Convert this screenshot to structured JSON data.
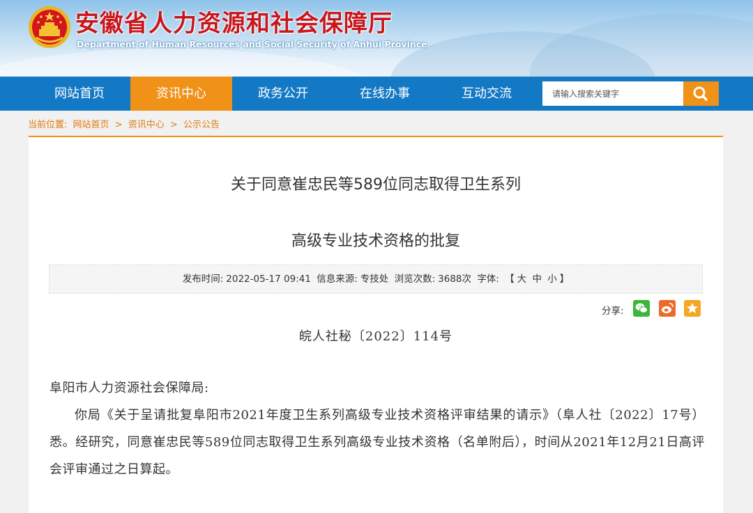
{
  "header": {
    "title": "安徽省人力资源和社会保障厅",
    "subtitle": "Department of Human Resources and Social Security of Anhui Province",
    "emblem_icon": "national-emblem",
    "title_color": "#c8161d"
  },
  "nav": {
    "items": [
      {
        "label": "网站首页"
      },
      {
        "label": "资讯中心"
      },
      {
        "label": "政务公开"
      },
      {
        "label": "在线办事"
      },
      {
        "label": "互动交流"
      }
    ],
    "active_index": 1,
    "bg_color": "#1479c5",
    "active_color": "#f09118",
    "search": {
      "placeholder": "请输入搜索关键字",
      "value": "",
      "button_icon": "search-icon"
    }
  },
  "breadcrumb": {
    "prefix": "当前位置:",
    "items": [
      "网站首页",
      "资讯中心",
      "公示公告"
    ],
    "separator": ">"
  },
  "article": {
    "title_line1": "关于同意崔忠民等589位同志取得卫生系列",
    "title_line2": "高级专业技术资格的批复",
    "meta": {
      "publish_label": "发布时间:",
      "publish_time": "2022-05-17 09:41",
      "source_label": "信息来源:",
      "source": "专技处",
      "views_label": "浏览次数:",
      "views": "3688次",
      "font_label": "字体:",
      "font_open": "【",
      "font_large": "大",
      "font_medium": "中",
      "font_small": "小",
      "font_close": "】"
    },
    "share": {
      "label": "分享:",
      "buttons": [
        "wechat-icon",
        "weibo-icon",
        "favorite-star-icon"
      ]
    },
    "doc_number": "皖人社秘〔2022〕114号",
    "recipient": "阜阳市人力资源社会保障局:",
    "paragraph": "你局《关于呈请批复阜阳市2021年度卫生系列高级专业技术资格评审结果的请示》（阜人社〔2022〕17号）悉。经研究，同意崔忠民等589位同志取得卫生系列高级专业技术资格（名单附后），时间从2021年12月21日高评会评审通过之日算起。"
  }
}
